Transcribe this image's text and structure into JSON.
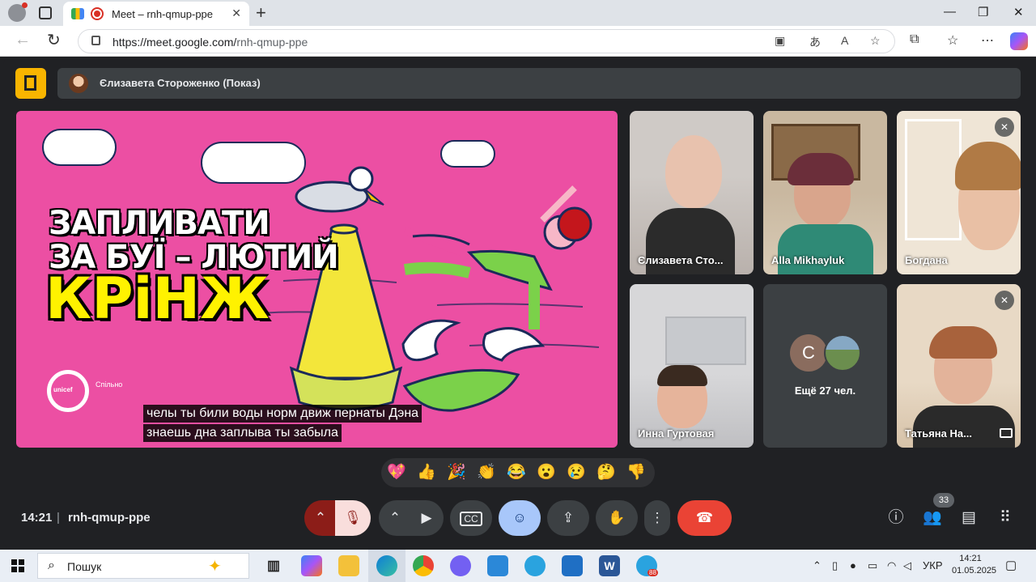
{
  "browser": {
    "tab_title": "Meet – rnh-qmup-ppe",
    "tab_close": "✕",
    "new_tab": "+",
    "url_host": "https://meet.google.com/",
    "url_path": "rnh-qmup-ppe",
    "window_controls": [
      "—",
      "❐",
      "✕"
    ]
  },
  "meet": {
    "presenter_label": "Єлизавета Стороженко (Показ)",
    "slide": {
      "title_line1": "ЗАПЛИВАТИ",
      "title_line2": "ЗА БУЇ – ЛЮТИЙ",
      "title_big": "КРіНЖ",
      "logo_text": "unicef",
      "brand_text": "Спільно"
    },
    "captions": [
      "челы ты били воды норм движ пернаты Дэна",
      "знаешь дна заплыва ты забыла"
    ],
    "participants": [
      {
        "name": "Єлизавета Сто...",
        "muted": false
      },
      {
        "name": "Alla Mikhayluk",
        "muted": false
      },
      {
        "name": "Богдана",
        "muted": true
      },
      {
        "name": "Инна Гуртовая",
        "muted": false
      },
      {
        "name": "Татьяна На...",
        "muted": true
      }
    ],
    "more_tile": {
      "avatar_letter": "С",
      "label": "Ещё 27 чел."
    },
    "reactions": [
      "💖",
      "👍",
      "🎉",
      "👏",
      "😂",
      "😮",
      "😢",
      "🤔",
      "👎"
    ],
    "time": "14:21",
    "separator": "|",
    "meeting_code": "rnh-qmup-ppe",
    "participant_count": "33",
    "colors": {
      "end_call": "#ea4335",
      "accent": "#a8c7fa",
      "mic_off": "#f9dedc",
      "slide_bg": "#ec4fa3"
    }
  },
  "taskbar": {
    "search_placeholder": "Пошук",
    "language": "УКР",
    "time": "14:21",
    "date": "01.05.2025",
    "telegram_badge": "88"
  }
}
